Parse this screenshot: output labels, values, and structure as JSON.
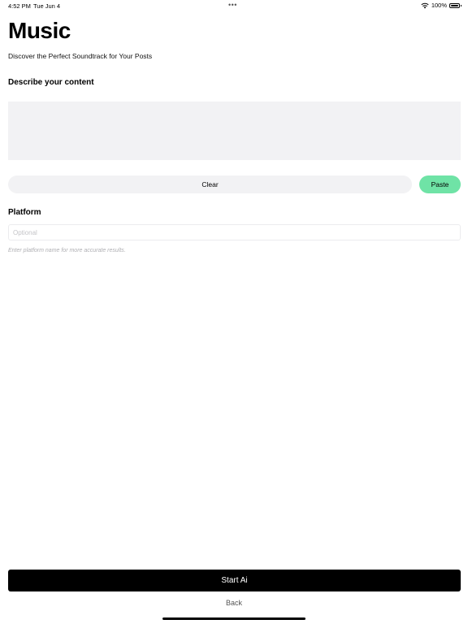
{
  "status_bar": {
    "time": "4:52 PM",
    "date": "Tue Jun 4",
    "dots": "•••",
    "battery": "100%"
  },
  "header": {
    "title": "Music",
    "subtitle": "Discover the Perfect Soundtrack for Your Posts"
  },
  "content": {
    "label": "Describe your content",
    "value": ""
  },
  "actions": {
    "clear_label": "Clear",
    "paste_label": "Paste"
  },
  "platform": {
    "label": "Platform",
    "placeholder": "Optional",
    "value": "",
    "hint": "Enter platform name for more accurate results."
  },
  "footer": {
    "start_label": "Start Ai",
    "back_label": "Back"
  },
  "colors": {
    "accent": "#6fe3a6",
    "primary_button": "#000000",
    "field_background": "#f2f2f4"
  },
  "icons": {
    "wifi": "wifi-icon",
    "battery": "battery-icon"
  }
}
